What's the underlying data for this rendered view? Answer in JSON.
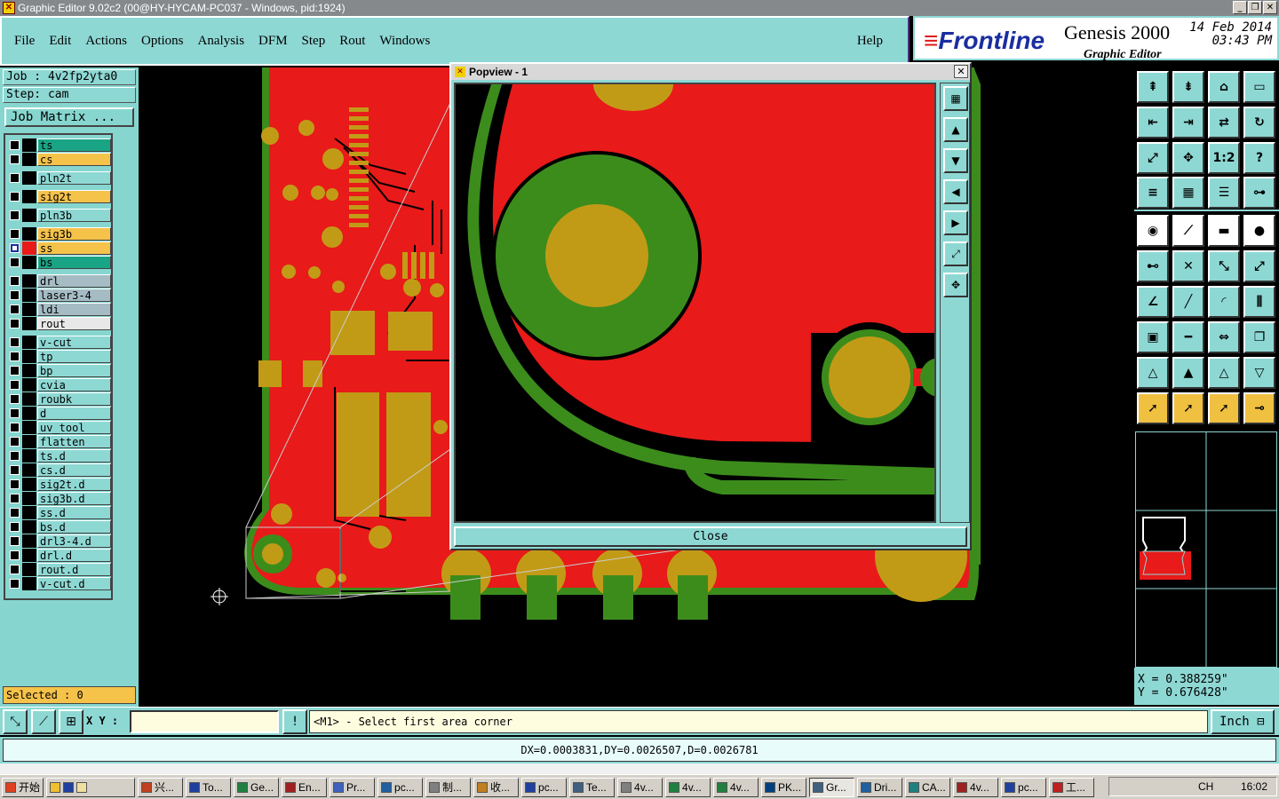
{
  "window": {
    "title": "Graphic Editor 9.02c2 (00@HY-HYCAM-PC037 - Windows, pid:1924)",
    "min": "_",
    "max": "❐",
    "close": "✕"
  },
  "menu": [
    "File",
    "Edit",
    "Actions",
    "Options",
    "Analysis",
    "DFM",
    "Step",
    "Rout",
    "Windows"
  ],
  "help": "Help",
  "brand": {
    "logo": "Frontline",
    "product": "Genesis 2000",
    "subtitle": "Graphic Editor",
    "date": "14 Feb 2014",
    "time": "03:43 PM"
  },
  "job": {
    "label": "Job : 4v2fp2yta0",
    "step": "Step: cam",
    "matrix_button": "Job Matrix ..."
  },
  "layers": [
    {
      "name": "ts",
      "color": "#1aa486",
      "sw": "#1aa486",
      "group": 0
    },
    {
      "name": "cs",
      "color": "#f5c24a",
      "sw": "#f5c24a",
      "group": 0
    },
    {
      "name": "pln2t",
      "color": "#8ed8d4",
      "sw": "#8ed8d4",
      "group": 1
    },
    {
      "name": "sig2t",
      "color": "#f5c24a",
      "sw": "#f5c24a",
      "group": 2
    },
    {
      "name": "pln3b",
      "color": "#8ed8d4",
      "sw": "#8ed8d4",
      "group": 3
    },
    {
      "name": "sig3b",
      "color": "#f5c24a",
      "sw": "#f5c24a",
      "group": 4
    },
    {
      "name": "ss",
      "color": "#f5c24a",
      "sw": "#e81a1a",
      "group": 4,
      "active": true
    },
    {
      "name": "bs",
      "color": "#1aa486",
      "sw": "#3c8c1c",
      "group": 4
    },
    {
      "name": "drl",
      "color": "#a6bcc4",
      "sw": "#a6bcc4",
      "group": 5
    },
    {
      "name": "laser3-4",
      "color": "#a6bcc4",
      "sw": "#a6bcc4",
      "group": 5
    },
    {
      "name": "ldi",
      "color": "#a6bcc4",
      "sw": "#a6bcc4",
      "group": 5
    },
    {
      "name": "rout",
      "color": "#e8e8e8",
      "sw": "#e8e8e8",
      "group": 5
    },
    {
      "name": "v-cut",
      "color": "#8ed8d4",
      "sw": "#8ed8d4",
      "group": 6
    },
    {
      "name": "tp",
      "color": "#8ed8d4",
      "sw": "#8ed8d4",
      "group": 6
    },
    {
      "name": "bp",
      "color": "#8ed8d4",
      "sw": "#8ed8d4",
      "group": 6
    },
    {
      "name": "cvia",
      "color": "#8ed8d4",
      "sw": "#8ed8d4",
      "group": 6
    },
    {
      "name": "roubk",
      "color": "#8ed8d4",
      "sw": "#8ed8d4",
      "group": 6
    },
    {
      "name": "d",
      "color": "#8ed8d4",
      "sw": "#8ed8d4",
      "group": 6
    },
    {
      "name": "uv_tool",
      "color": "#8ed8d4",
      "sw": "#8ed8d4",
      "group": 6
    },
    {
      "name": "flatten",
      "color": "#8ed8d4",
      "sw": "#8ed8d4",
      "group": 6
    },
    {
      "name": "ts.d",
      "color": "#8ed8d4",
      "sw": "#8ed8d4",
      "group": 6
    },
    {
      "name": "cs.d",
      "color": "#8ed8d4",
      "sw": "#8ed8d4",
      "group": 6
    },
    {
      "name": "sig2t.d",
      "color": "#8ed8d4",
      "sw": "#8ed8d4",
      "group": 6
    },
    {
      "name": "sig3b.d",
      "color": "#8ed8d4",
      "sw": "#8ed8d4",
      "group": 6
    },
    {
      "name": "ss.d",
      "color": "#8ed8d4",
      "sw": "#8ed8d4",
      "group": 6
    },
    {
      "name": "bs.d",
      "color": "#8ed8d4",
      "sw": "#8ed8d4",
      "group": 6
    },
    {
      "name": "drl3-4.d",
      "color": "#8ed8d4",
      "sw": "#8ed8d4",
      "group": 6
    },
    {
      "name": "drl.d",
      "color": "#8ed8d4",
      "sw": "#8ed8d4",
      "group": 6
    },
    {
      "name": "rout.d",
      "color": "#8ed8d4",
      "sw": "#8ed8d4",
      "group": 6
    },
    {
      "name": "v-cut.d",
      "color": "#8ed8d4",
      "sw": "#8ed8d4",
      "group": 6
    }
  ],
  "selected": "Selected : 0",
  "popview": {
    "title": "Popview - 1",
    "close_x": "✕",
    "close_button": "Close"
  },
  "coords": {
    "x": "X  =  0.388259\"",
    "y": "Y  =  0.676428\""
  },
  "command": {
    "xy_label": "X Y :",
    "xy_value": "",
    "info": "!",
    "prompt": "<M1> - Select first area corner",
    "units": "Inch"
  },
  "status": "DX=0.0003831,DY=0.0026507,D=0.0026781",
  "taskbar": {
    "start": "开始",
    "items": [
      "兴...",
      "To...",
      "Ge...",
      "En...",
      "Pr...",
      "pc...",
      "制...",
      "收...",
      "pc...",
      "Te...",
      "4v...",
      "4v...",
      "4v...",
      "PK...",
      "Gr...",
      "Dri...",
      "CA...",
      "4v...",
      "pc...",
      "工..."
    ],
    "active_index": 14,
    "clock": "16:02",
    "tray_text": "CH"
  },
  "toolbar_icons": {
    "top": [
      "1:2",
      "?"
    ],
    "mid": []
  },
  "colors": {
    "panel": "#8ed8d4",
    "copper": "#e81a1a",
    "pad": "#c29b16",
    "mask": "#3c8c1c",
    "highlight": "#f5c24a"
  }
}
